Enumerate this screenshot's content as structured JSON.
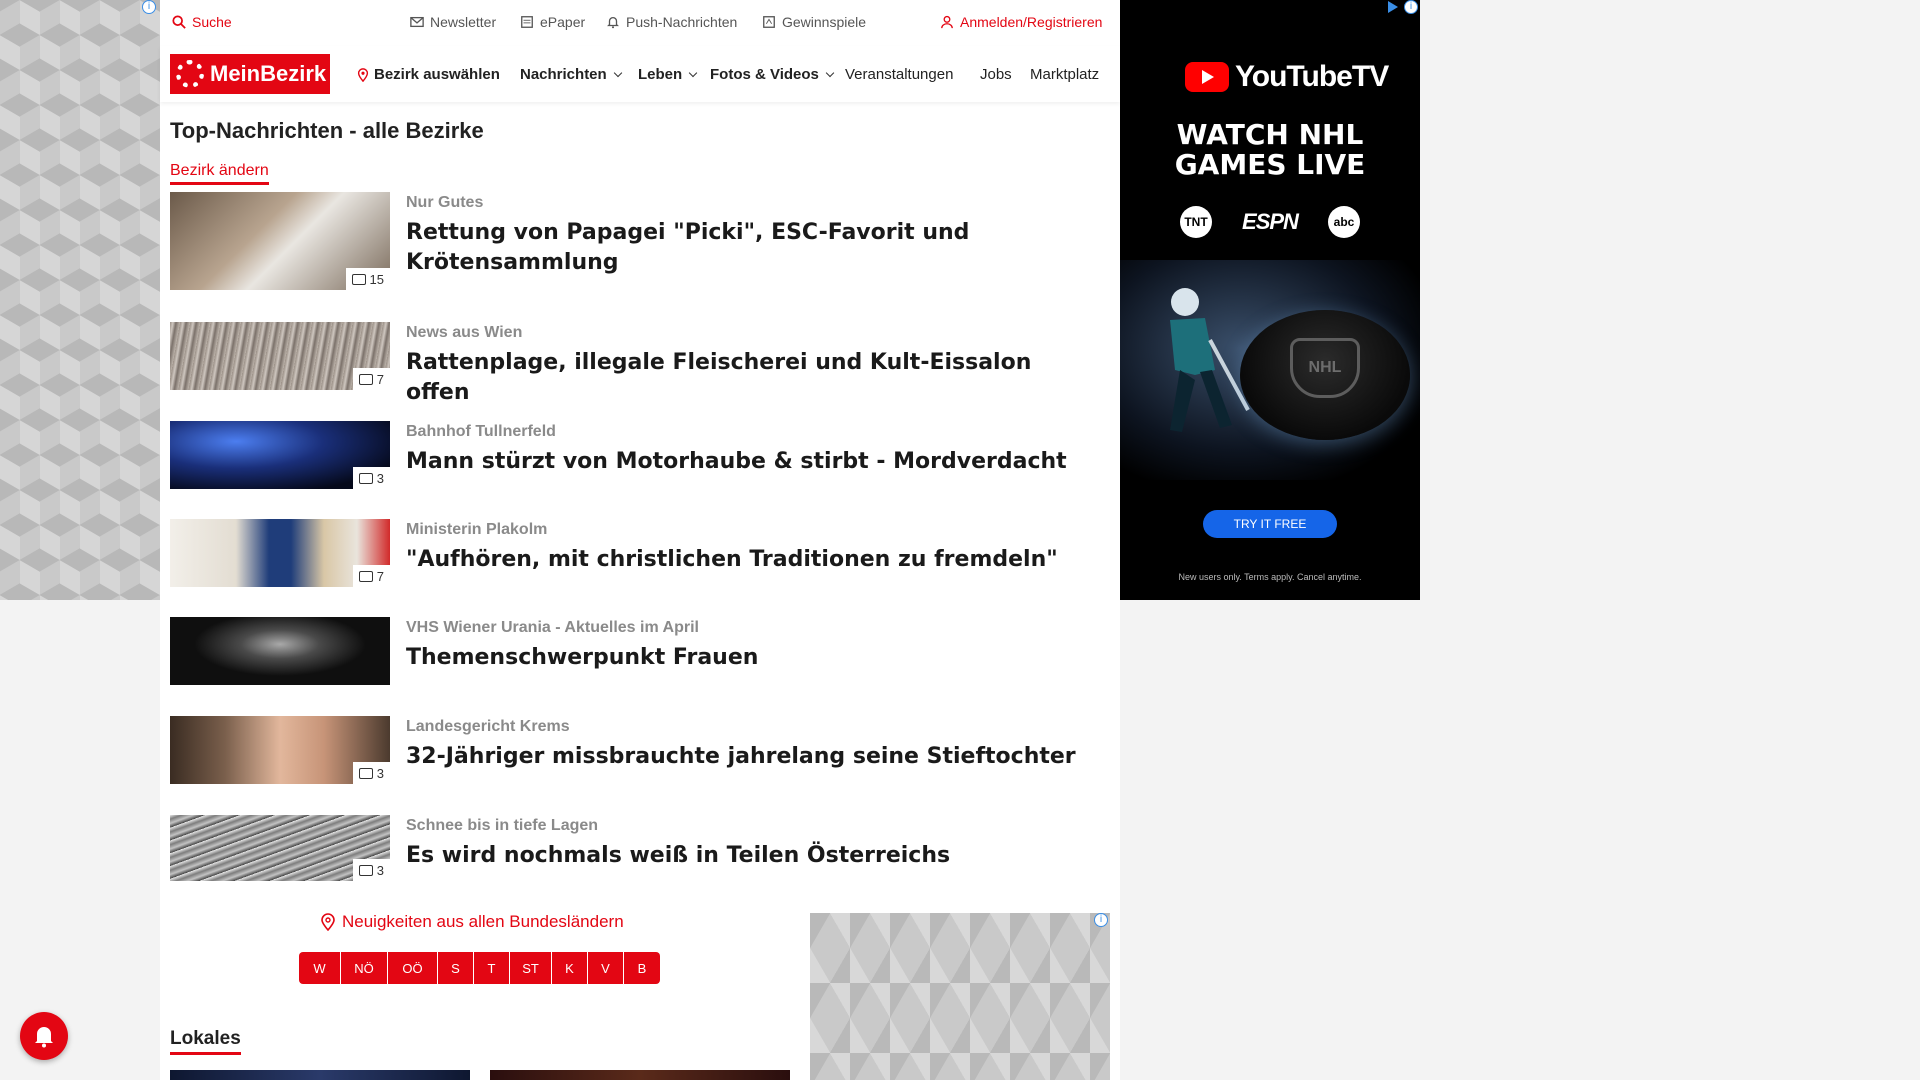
{
  "topbar": {
    "search": "Suche",
    "newsletter": "Newsletter",
    "epaper": "ePaper",
    "push": "Push-Nachrichten",
    "games": "Gewinnspiele",
    "login": "Anmelden/Registrieren"
  },
  "nav": {
    "logo": "MeinBezirk",
    "district": "Bezirk auswählen",
    "items": [
      "Nachrichten",
      "Leben",
      "Fotos & Videos",
      "Veranstaltungen",
      "Jobs",
      "Marktplatz"
    ]
  },
  "main": {
    "title": "Top-Nachrichten - alle Bezirke",
    "change_district": "Bezirk ändern",
    "articles": [
      {
        "kicker": "Nur Gutes",
        "headline": "Rettung von Papagei \"Picki\", ESC-Favorit und Krötensammlung",
        "count": "15"
      },
      {
        "kicker": "News aus Wien",
        "headline": "Rattenplage, illegale Fleischerei und Kult-Eissalon offen",
        "count": "7"
      },
      {
        "kicker": "Bahnhof Tullnerfeld",
        "headline": "Mann stürzt von Motorhaube & stirbt - Mordverdacht",
        "count": "3"
      },
      {
        "kicker": "Ministerin Plakolm",
        "headline": "\"Aufhören, mit christlichen Traditionen zu fremdeln\"",
        "count": "7"
      },
      {
        "kicker": "VHS Wiener Urania - Aktuelles im April",
        "headline": "Themenschwerpunkt Frauen",
        "count": ""
      },
      {
        "kicker": "Landesgericht Krems",
        "headline": "32-Jähriger missbrauchte jahrelang seine Stieftochter",
        "count": "3"
      },
      {
        "kicker": "Schnee bis in tiefe Lagen",
        "headline": "Es wird nochmals weiß in Teilen Österreichs",
        "count": "3"
      }
    ],
    "states_title": "Neuigkeiten aus allen Bundesländern",
    "states": [
      "W",
      "NÖ",
      "OÖ",
      "S",
      "T",
      "ST",
      "K",
      "V",
      "B"
    ],
    "lokales": "Lokales"
  },
  "ad": {
    "brand": "YouTubeTV",
    "headline_1": "WATCH NHL",
    "headline_2": "GAMES LIVE",
    "networks": [
      "TNT",
      "ESPN",
      "abc"
    ],
    "puck_logo": "NHL",
    "cta": "TRY IT FREE",
    "fine_print": "New users only. Terms apply. Cancel anytime."
  },
  "colors": {
    "accent": "#e30613",
    "cta": "#1565e8"
  }
}
